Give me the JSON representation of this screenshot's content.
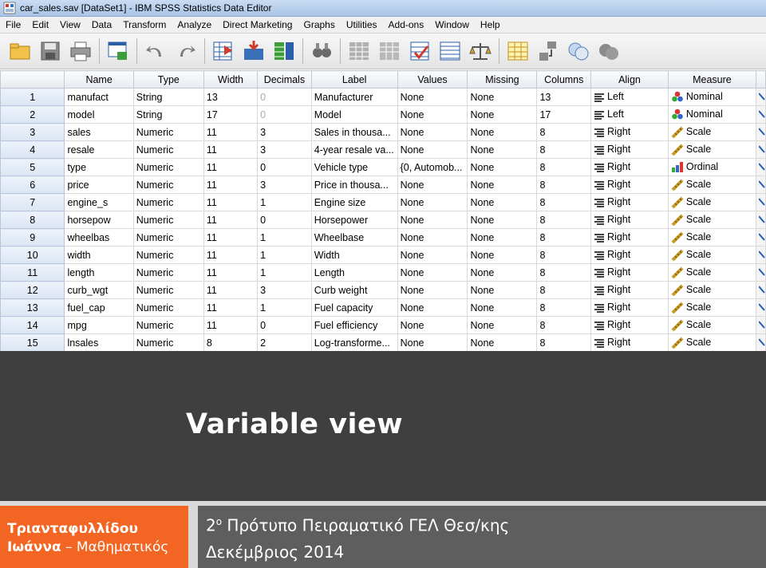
{
  "window": {
    "title": "car_sales.sav [DataSet1] - IBM SPSS Statistics Data Editor"
  },
  "menu": [
    "File",
    "Edit",
    "View",
    "Data",
    "Transform",
    "Analyze",
    "Direct Marketing",
    "Graphs",
    "Utilities",
    "Add-ons",
    "Window",
    "Help"
  ],
  "toolbar": {
    "buttons": [
      "open-icon",
      "save-icon",
      "print-icon",
      "dialog-recall-icon",
      "undo-icon",
      "redo-icon",
      "goto-case-icon",
      "goto-variable-icon",
      "variables-icon",
      "find-icon",
      "insert-cases-icon",
      "insert-variable-icon",
      "split-file-icon",
      "weight-cases-icon",
      "select-cases-icon",
      "value-labels-icon",
      "use-variable-sets-icon",
      "show-all-variables-icon",
      "spell-check-icon"
    ]
  },
  "table": {
    "columns": [
      "Name",
      "Type",
      "Width",
      "Decimals",
      "Label",
      "Values",
      "Missing",
      "Columns",
      "Align",
      "Measure"
    ],
    "rows": [
      {
        "n": "1",
        "name": "manufact",
        "type": "String",
        "width": "13",
        "decimals": "0",
        "label": "Manufacturer",
        "values": "None",
        "missing": "None",
        "columns": "13",
        "align": "Left",
        "measure": "Nominal"
      },
      {
        "n": "2",
        "name": "model",
        "type": "String",
        "width": "17",
        "decimals": "0",
        "label": "Model",
        "values": "None",
        "missing": "None",
        "columns": "17",
        "align": "Left",
        "measure": "Nominal"
      },
      {
        "n": "3",
        "name": "sales",
        "type": "Numeric",
        "width": "11",
        "decimals": "3",
        "label": "Sales in thousa...",
        "values": "None",
        "missing": "None",
        "columns": "8",
        "align": "Right",
        "measure": "Scale"
      },
      {
        "n": "4",
        "name": "resale",
        "type": "Numeric",
        "width": "11",
        "decimals": "3",
        "label": "4-year resale va...",
        "values": "None",
        "missing": "None",
        "columns": "8",
        "align": "Right",
        "measure": "Scale"
      },
      {
        "n": "5",
        "name": "type",
        "type": "Numeric",
        "width": "11",
        "decimals": "0",
        "label": "Vehicle type",
        "values": "{0, Automob...",
        "missing": "None",
        "columns": "8",
        "align": "Right",
        "measure": "Ordinal"
      },
      {
        "n": "6",
        "name": "price",
        "type": "Numeric",
        "width": "11",
        "decimals": "3",
        "label": "Price in thousa...",
        "values": "None",
        "missing": "None",
        "columns": "8",
        "align": "Right",
        "measure": "Scale"
      },
      {
        "n": "7",
        "name": "engine_s",
        "type": "Numeric",
        "width": "11",
        "decimals": "1",
        "label": "Engine size",
        "values": "None",
        "missing": "None",
        "columns": "8",
        "align": "Right",
        "measure": "Scale"
      },
      {
        "n": "8",
        "name": "horsepow",
        "type": "Numeric",
        "width": "11",
        "decimals": "0",
        "label": "Horsepower",
        "values": "None",
        "missing": "None",
        "columns": "8",
        "align": "Right",
        "measure": "Scale"
      },
      {
        "n": "9",
        "name": "wheelbas",
        "type": "Numeric",
        "width": "11",
        "decimals": "1",
        "label": "Wheelbase",
        "values": "None",
        "missing": "None",
        "columns": "8",
        "align": "Right",
        "measure": "Scale"
      },
      {
        "n": "10",
        "name": "width",
        "type": "Numeric",
        "width": "11",
        "decimals": "1",
        "label": "Width",
        "values": "None",
        "missing": "None",
        "columns": "8",
        "align": "Right",
        "measure": "Scale"
      },
      {
        "n": "11",
        "name": "length",
        "type": "Numeric",
        "width": "11",
        "decimals": "1",
        "label": "Length",
        "values": "None",
        "missing": "None",
        "columns": "8",
        "align": "Right",
        "measure": "Scale"
      },
      {
        "n": "12",
        "name": "curb_wgt",
        "type": "Numeric",
        "width": "11",
        "decimals": "3",
        "label": "Curb weight",
        "values": "None",
        "missing": "None",
        "columns": "8",
        "align": "Right",
        "measure": "Scale"
      },
      {
        "n": "13",
        "name": "fuel_cap",
        "type": "Numeric",
        "width": "11",
        "decimals": "1",
        "label": "Fuel capacity",
        "values": "None",
        "missing": "None",
        "columns": "8",
        "align": "Right",
        "measure": "Scale"
      },
      {
        "n": "14",
        "name": "mpg",
        "type": "Numeric",
        "width": "11",
        "decimals": "0",
        "label": "Fuel efficiency",
        "values": "None",
        "missing": "None",
        "columns": "8",
        "align": "Right",
        "measure": "Scale"
      },
      {
        "n": "15",
        "name": "lnsales",
        "type": "Numeric",
        "width": "8",
        "decimals": "2",
        "label": "Log-transforme...",
        "values": "None",
        "missing": "None",
        "columns": "8",
        "align": "Right",
        "measure": "Scale"
      }
    ]
  },
  "slide": {
    "title": "Variable view",
    "author_line1": "Τριανταφυλλίδου",
    "author_line2_bold": "Ιωάννα",
    "author_line2_rest": " – Μαθηματικός",
    "school_num": "2",
    "school_sup": "ο",
    "school_rest": " Πρότυπο Πειραματικό ΓΕΛ Θεσ/κης",
    "date": "Δεκέμβριος 2014"
  },
  "colors": {
    "orange": "#f26522",
    "dark": "#3f3f3f",
    "footer_grey": "#5e5e5e"
  }
}
